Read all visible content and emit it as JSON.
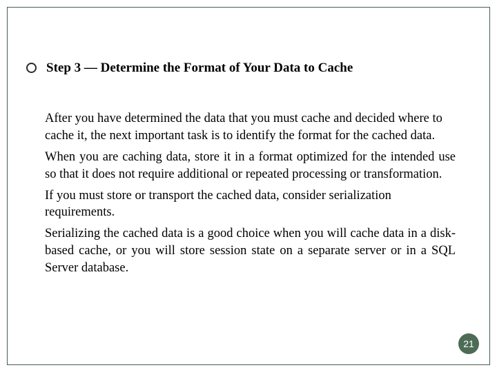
{
  "title": "Step 3 — Determine the Format of Your Data to Cache",
  "paragraphs": {
    "p1": "After you have determined the data that you must cache and decided where to cache it, the next important task is to identify the format for the cached data.",
    "p2": "When you are caching data, store it in a format optimized for the intended use so that it does not require additional or repeated processing or transformation.",
    "p3": "If you must store or transport the cached data, consider serialization requirements.",
    "p4": "Serializing the cached data is a good choice when you will cache data in a disk-based cache, or you will store session state on a separate server or in a SQL Server database."
  },
  "page_number": "21"
}
